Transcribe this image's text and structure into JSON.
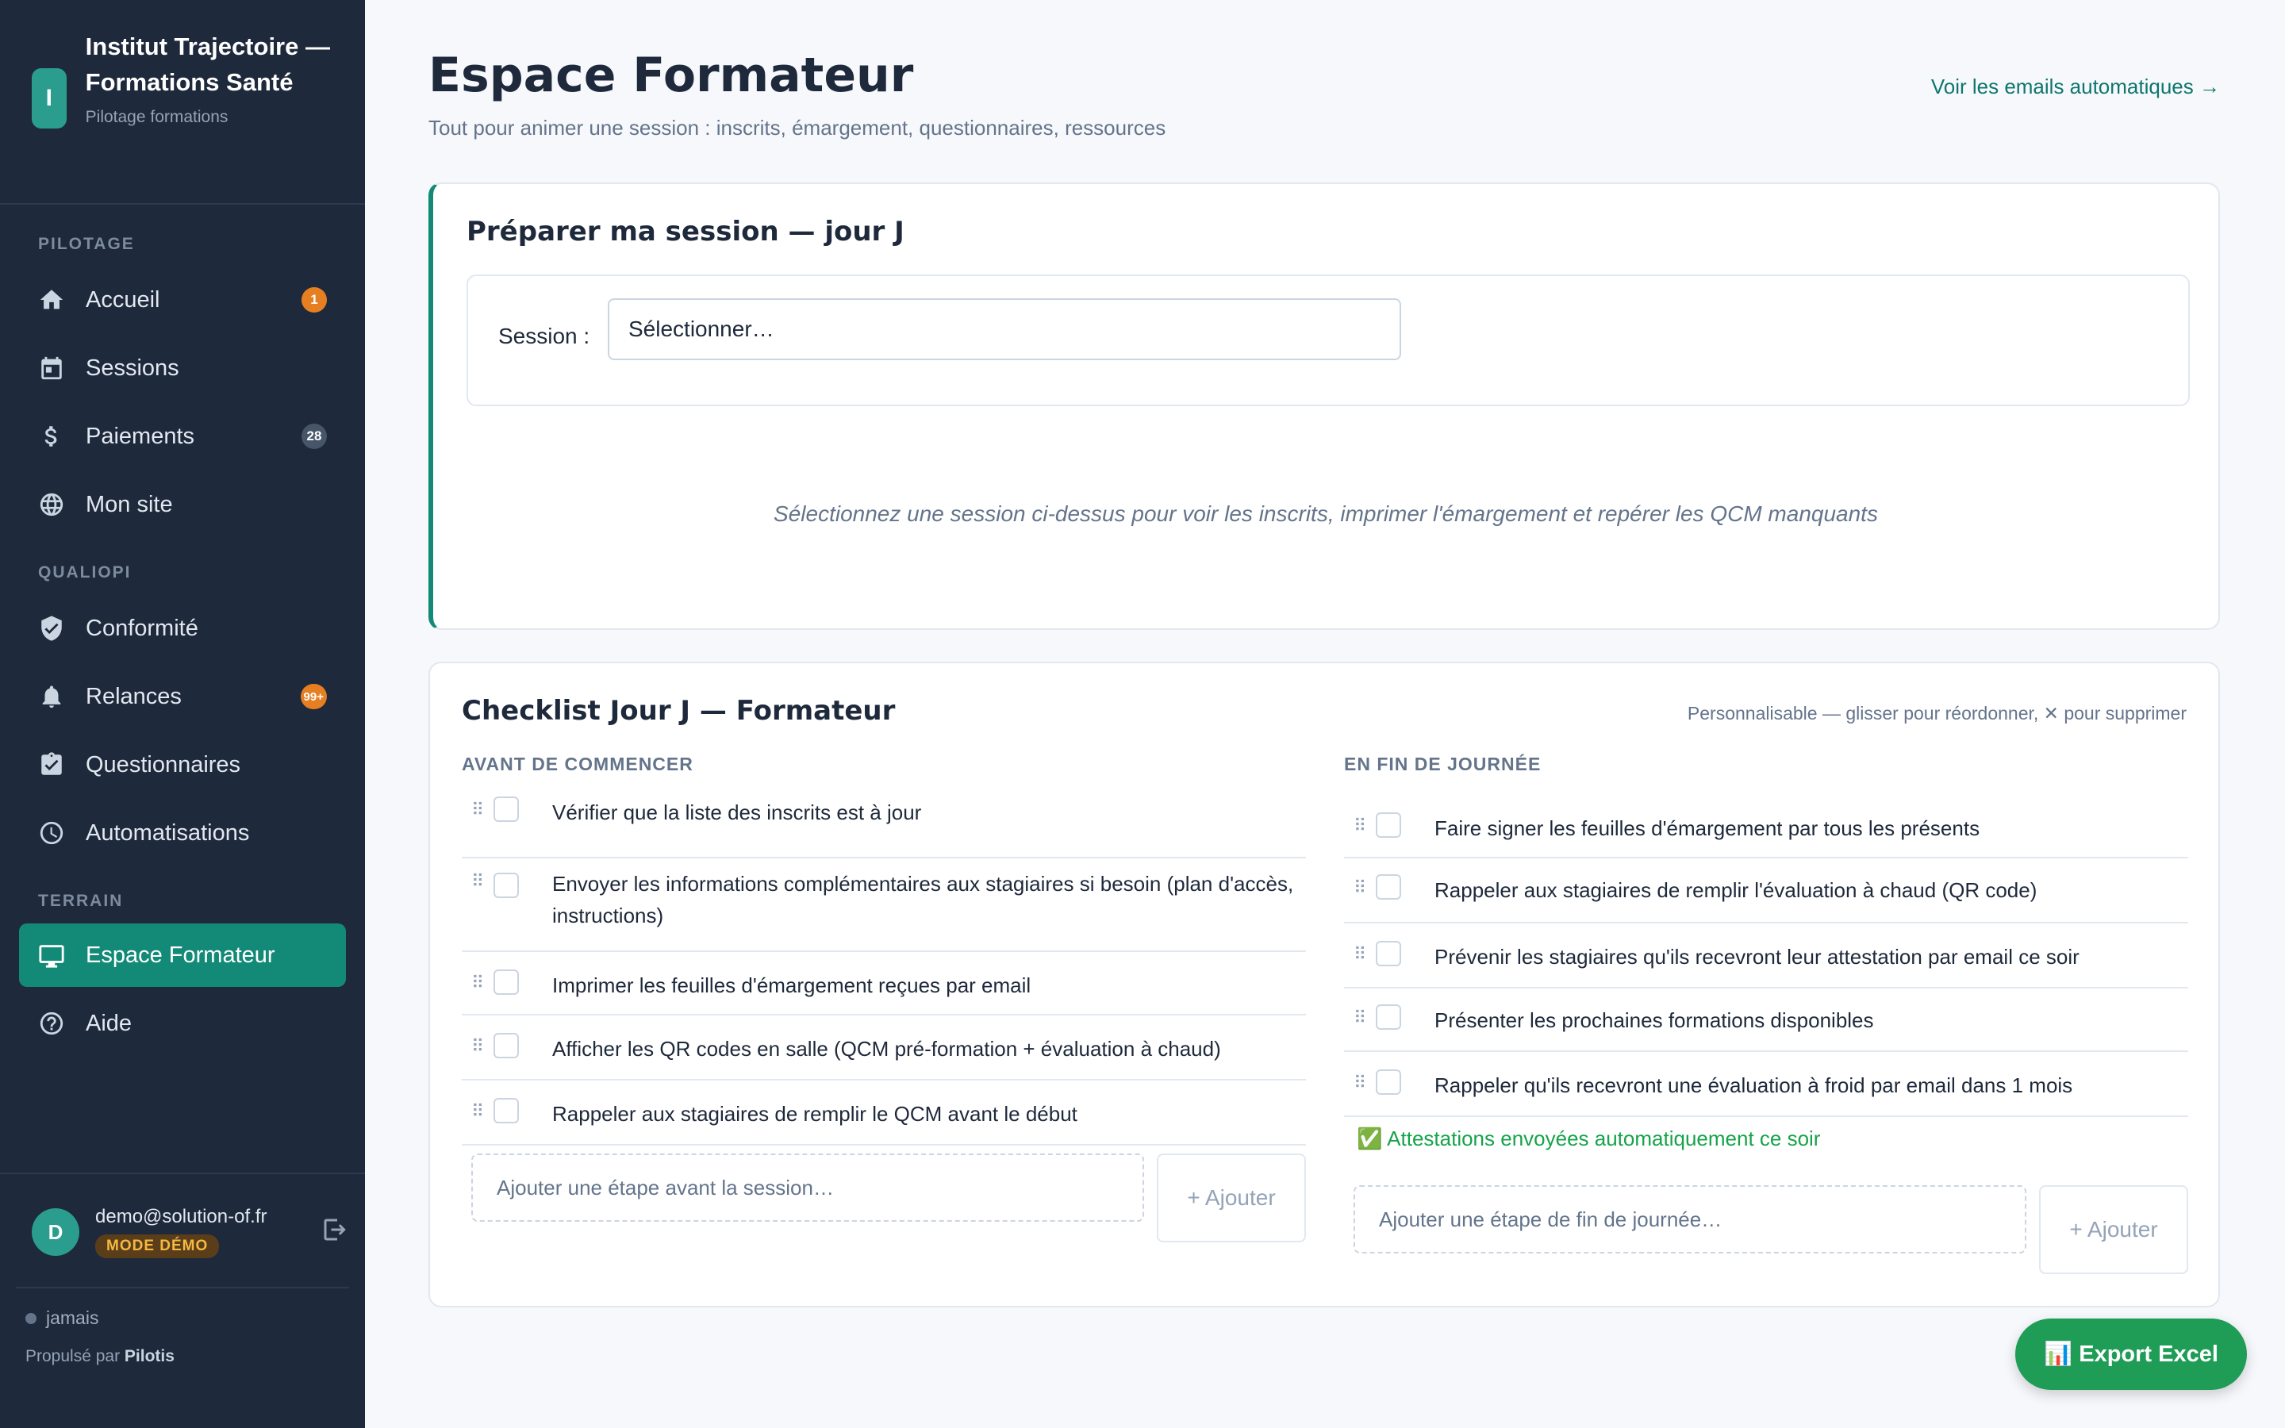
{
  "brand": {
    "logo_letter": "I",
    "name": "Institut Trajectoire — Formations Santé",
    "subtitle": "Pilotage formations"
  },
  "sidebar": {
    "sections": [
      {
        "title": "PILOTAGE"
      },
      {
        "title": "QUALIOPI"
      },
      {
        "title": "TERRAIN"
      }
    ],
    "items": [
      {
        "label": "Accueil",
        "icon": "home-icon",
        "badge": "1"
      },
      {
        "label": "Sessions",
        "icon": "calendar-icon"
      },
      {
        "label": "Paiements",
        "icon": "dollar-icon",
        "badge": "28"
      },
      {
        "label": "Mon site",
        "icon": "globe-icon"
      },
      {
        "label": "Conformité",
        "icon": "shield-check-icon"
      },
      {
        "label": "Relances",
        "icon": "bell-icon",
        "badge": "99+"
      },
      {
        "label": "Questionnaires",
        "icon": "clipboard-check-icon"
      },
      {
        "label": "Automatisations",
        "icon": "clock-icon"
      },
      {
        "label": "Espace Formateur",
        "icon": "monitor-icon",
        "active": true
      },
      {
        "label": "Aide",
        "icon": "help-circle-icon"
      }
    ],
    "user": {
      "avatar_letter": "D",
      "email": "demo@solution-of.fr",
      "mode_badge": "MODE DÉMO"
    },
    "status": "jamais",
    "powered_prefix": "Propulsé par",
    "powered_brand": "Pilotis"
  },
  "header": {
    "title": "Espace Formateur",
    "subtitle": "Tout pour animer une session : inscrits, émargement, questionnaires, ressources",
    "link": "Voir les emails automatiques →"
  },
  "prepare": {
    "title": "Préparer ma session — jour J",
    "session_label": "Session :",
    "session_value": "Sélectionner…",
    "empty_message": "Sélectionnez une session ci-dessus pour voir les inscrits, imprimer l'émargement et repérer les QCM manquants"
  },
  "checklist": {
    "title": "Checklist Jour J — Formateur",
    "hint": "Personnalisable — glisser pour réordonner, ✕ pour supprimer",
    "before": {
      "title": "AVANT DE COMMENCER",
      "items": [
        "Vérifier que la liste des inscrits est à jour",
        "Envoyer les informations complémentaires aux stagiaires si besoin (plan d'accès, instructions)",
        "Imprimer les feuilles d'émargement reçues par email",
        "Afficher les QR codes en salle (QCM pré-formation + évaluation à chaud)",
        "Rappeler aux stagiaires de remplir le QCM avant le début"
      ],
      "add_placeholder": "Ajouter une étape avant la session…",
      "add_button": "+ Ajouter"
    },
    "after": {
      "title": "EN FIN DE JOURNÉE",
      "items": [
        "Faire signer les feuilles d'émargement par tous les présents",
        "Rappeler aux stagiaires de remplir l'évaluation à chaud (QR code)",
        "Prévenir les stagiaires qu'ils recevront leur attestation par email ce soir",
        "Présenter les prochaines formations disponibles",
        "Rappeler qu'ils recevront une évaluation à froid par email dans 1 mois"
      ],
      "auto_note": "✅ Attestations envoyées automatiquement ce soir",
      "add_placeholder": "Ajouter une étape de fin de journée…",
      "add_button": "+ Ajouter"
    }
  },
  "export_button": "📊 Export Excel",
  "colors": {
    "accent": "#138a77",
    "sidebar_bg": "#1e293b",
    "badge_orange": "#e67e22",
    "export_green": "#1f9d57"
  }
}
